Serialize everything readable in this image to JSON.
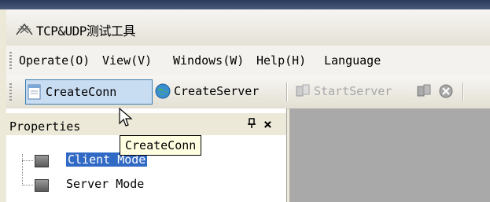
{
  "window": {
    "title": "TCP&UDP测试工具",
    "app_icon": "network-tools-icon"
  },
  "menubar": {
    "items": [
      {
        "label": "Operate(O)"
      },
      {
        "label": "View(V)"
      },
      {
        "label": "Windows(W)"
      },
      {
        "label": "Help(H)"
      },
      {
        "label": "Language"
      }
    ]
  },
  "toolbar": {
    "create_conn": {
      "label": "CreateConn",
      "icon": "document-icon"
    },
    "create_server": {
      "label": "CreateServer",
      "icon": "globe-icon"
    },
    "start_server": {
      "label": "StartServer",
      "icon": "server-icon"
    },
    "extra_icons": [
      "server-stop-icon",
      "stop-circle-icon"
    ]
  },
  "properties_panel": {
    "title": "Properties",
    "pin_icon": "pin-icon",
    "close_icon": "close-icon",
    "tree": [
      {
        "label": "Client Mode",
        "selected": true
      },
      {
        "label": "Server Mode",
        "selected": false
      }
    ]
  },
  "tooltip": {
    "text": "CreateConn"
  },
  "colors": {
    "selection": "#316ac5",
    "tooltip_bg": "#ffffe1",
    "doc_area": "#a9a9a9"
  }
}
